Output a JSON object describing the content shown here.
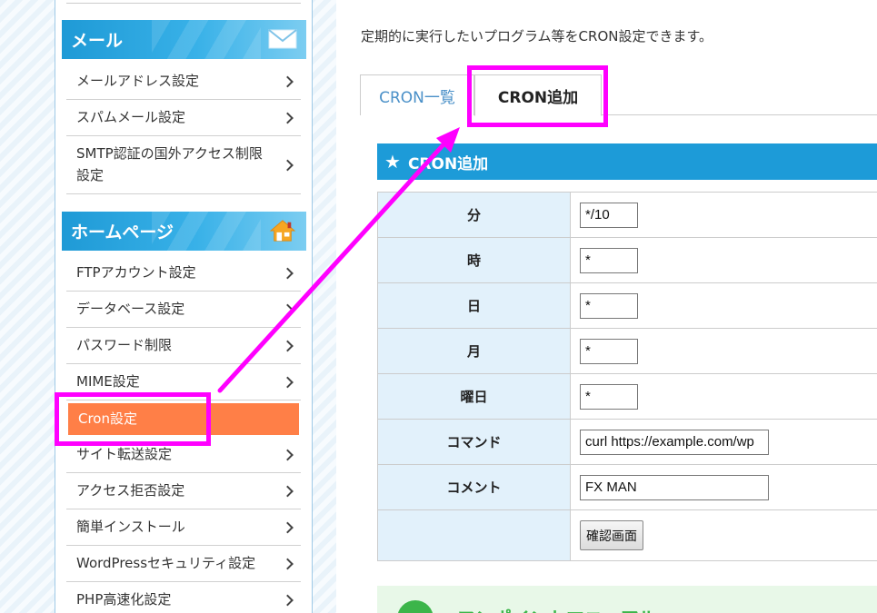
{
  "sidebar": {
    "categories": [
      {
        "title": "メール",
        "icon": "envelope-icon",
        "items": [
          {
            "label": "メールアドレス設定"
          },
          {
            "label": "スパムメール設定"
          },
          {
            "label": "SMTP認証の国外アクセス制限設定"
          }
        ]
      },
      {
        "title": "ホームページ",
        "icon": "house-icon",
        "items": [
          {
            "label": "FTPアカウント設定"
          },
          {
            "label": "データベース設定"
          },
          {
            "label": "パスワード制限"
          },
          {
            "label": "MIME設定"
          },
          {
            "label": "Cron設定",
            "active": true
          },
          {
            "label": "サイト転送設定"
          },
          {
            "label": "アクセス拒否設定"
          },
          {
            "label": "簡単インストール"
          },
          {
            "label": "WordPressセキュリティ設定"
          },
          {
            "label": "PHP高速化設定"
          }
        ]
      }
    ]
  },
  "main": {
    "intro": "定期的に実行したいプログラム等をCRON設定できます。",
    "tabs": [
      {
        "label": "CRON一覧",
        "active": false
      },
      {
        "label": "CRON追加",
        "active": true
      }
    ],
    "panel_title": "CRON追加",
    "form": {
      "minute": {
        "label": "分",
        "value": "*/10"
      },
      "hour": {
        "label": "時",
        "value": "*"
      },
      "day": {
        "label": "日",
        "value": "*"
      },
      "month": {
        "label": "月",
        "value": "*"
      },
      "weekday": {
        "label": "曜日",
        "value": "*"
      },
      "command": {
        "label": "コマンド",
        "value": "curl https://example.com/wp"
      },
      "comment": {
        "label": "コメント",
        "value": "FX MAN"
      },
      "confirm_label": "確認画面"
    },
    "onepoint_title": "ワンポイントマニュアル"
  },
  "colors": {
    "accent_blue": "#1d9bd8",
    "active_orange": "#ff7f47",
    "highlight_magenta": "#ff00ff",
    "label_bg": "#e2f1fb"
  }
}
